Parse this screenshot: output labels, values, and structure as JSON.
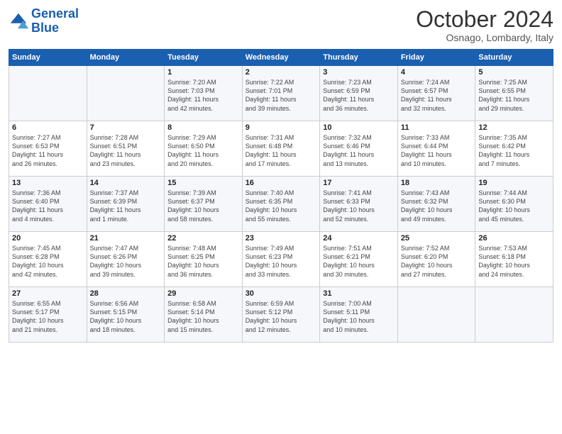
{
  "header": {
    "logo_line1": "General",
    "logo_line2": "Blue",
    "month_title": "October 2024",
    "location": "Osnago, Lombardy, Italy"
  },
  "weekdays": [
    "Sunday",
    "Monday",
    "Tuesday",
    "Wednesday",
    "Thursday",
    "Friday",
    "Saturday"
  ],
  "weeks": [
    [
      {
        "day": "",
        "content": ""
      },
      {
        "day": "",
        "content": ""
      },
      {
        "day": "1",
        "content": "Sunrise: 7:20 AM\nSunset: 7:03 PM\nDaylight: 11 hours\nand 42 minutes."
      },
      {
        "day": "2",
        "content": "Sunrise: 7:22 AM\nSunset: 7:01 PM\nDaylight: 11 hours\nand 39 minutes."
      },
      {
        "day": "3",
        "content": "Sunrise: 7:23 AM\nSunset: 6:59 PM\nDaylight: 11 hours\nand 36 minutes."
      },
      {
        "day": "4",
        "content": "Sunrise: 7:24 AM\nSunset: 6:57 PM\nDaylight: 11 hours\nand 32 minutes."
      },
      {
        "day": "5",
        "content": "Sunrise: 7:25 AM\nSunset: 6:55 PM\nDaylight: 11 hours\nand 29 minutes."
      }
    ],
    [
      {
        "day": "6",
        "content": "Sunrise: 7:27 AM\nSunset: 6:53 PM\nDaylight: 11 hours\nand 26 minutes."
      },
      {
        "day": "7",
        "content": "Sunrise: 7:28 AM\nSunset: 6:51 PM\nDaylight: 11 hours\nand 23 minutes."
      },
      {
        "day": "8",
        "content": "Sunrise: 7:29 AM\nSunset: 6:50 PM\nDaylight: 11 hours\nand 20 minutes."
      },
      {
        "day": "9",
        "content": "Sunrise: 7:31 AM\nSunset: 6:48 PM\nDaylight: 11 hours\nand 17 minutes."
      },
      {
        "day": "10",
        "content": "Sunrise: 7:32 AM\nSunset: 6:46 PM\nDaylight: 11 hours\nand 13 minutes."
      },
      {
        "day": "11",
        "content": "Sunrise: 7:33 AM\nSunset: 6:44 PM\nDaylight: 11 hours\nand 10 minutes."
      },
      {
        "day": "12",
        "content": "Sunrise: 7:35 AM\nSunset: 6:42 PM\nDaylight: 11 hours\nand 7 minutes."
      }
    ],
    [
      {
        "day": "13",
        "content": "Sunrise: 7:36 AM\nSunset: 6:40 PM\nDaylight: 11 hours\nand 4 minutes."
      },
      {
        "day": "14",
        "content": "Sunrise: 7:37 AM\nSunset: 6:39 PM\nDaylight: 11 hours\nand 1 minute."
      },
      {
        "day": "15",
        "content": "Sunrise: 7:39 AM\nSunset: 6:37 PM\nDaylight: 10 hours\nand 58 minutes."
      },
      {
        "day": "16",
        "content": "Sunrise: 7:40 AM\nSunset: 6:35 PM\nDaylight: 10 hours\nand 55 minutes."
      },
      {
        "day": "17",
        "content": "Sunrise: 7:41 AM\nSunset: 6:33 PM\nDaylight: 10 hours\nand 52 minutes."
      },
      {
        "day": "18",
        "content": "Sunrise: 7:43 AM\nSunset: 6:32 PM\nDaylight: 10 hours\nand 49 minutes."
      },
      {
        "day": "19",
        "content": "Sunrise: 7:44 AM\nSunset: 6:30 PM\nDaylight: 10 hours\nand 45 minutes."
      }
    ],
    [
      {
        "day": "20",
        "content": "Sunrise: 7:45 AM\nSunset: 6:28 PM\nDaylight: 10 hours\nand 42 minutes."
      },
      {
        "day": "21",
        "content": "Sunrise: 7:47 AM\nSunset: 6:26 PM\nDaylight: 10 hours\nand 39 minutes."
      },
      {
        "day": "22",
        "content": "Sunrise: 7:48 AM\nSunset: 6:25 PM\nDaylight: 10 hours\nand 36 minutes."
      },
      {
        "day": "23",
        "content": "Sunrise: 7:49 AM\nSunset: 6:23 PM\nDaylight: 10 hours\nand 33 minutes."
      },
      {
        "day": "24",
        "content": "Sunrise: 7:51 AM\nSunset: 6:21 PM\nDaylight: 10 hours\nand 30 minutes."
      },
      {
        "day": "25",
        "content": "Sunrise: 7:52 AM\nSunset: 6:20 PM\nDaylight: 10 hours\nand 27 minutes."
      },
      {
        "day": "26",
        "content": "Sunrise: 7:53 AM\nSunset: 6:18 PM\nDaylight: 10 hours\nand 24 minutes."
      }
    ],
    [
      {
        "day": "27",
        "content": "Sunrise: 6:55 AM\nSunset: 5:17 PM\nDaylight: 10 hours\nand 21 minutes."
      },
      {
        "day": "28",
        "content": "Sunrise: 6:56 AM\nSunset: 5:15 PM\nDaylight: 10 hours\nand 18 minutes."
      },
      {
        "day": "29",
        "content": "Sunrise: 6:58 AM\nSunset: 5:14 PM\nDaylight: 10 hours\nand 15 minutes."
      },
      {
        "day": "30",
        "content": "Sunrise: 6:59 AM\nSunset: 5:12 PM\nDaylight: 10 hours\nand 12 minutes."
      },
      {
        "day": "31",
        "content": "Sunrise: 7:00 AM\nSunset: 5:11 PM\nDaylight: 10 hours\nand 10 minutes."
      },
      {
        "day": "",
        "content": ""
      },
      {
        "day": "",
        "content": ""
      }
    ]
  ]
}
